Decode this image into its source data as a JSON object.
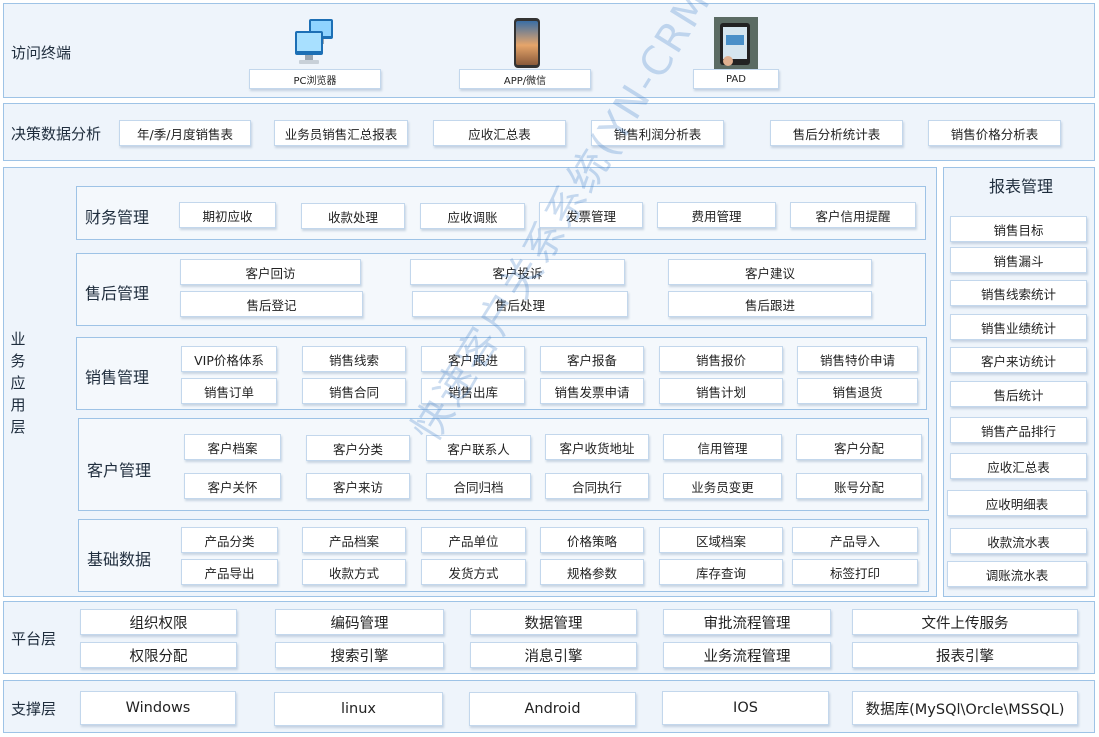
{
  "terminals": {
    "title": "访问终端",
    "items": [
      "PC浏览器",
      "APP/微信",
      "PAD"
    ]
  },
  "decision": {
    "title": "决策数据分析",
    "items": [
      "年/季/月度销售表",
      "业务员销售汇总报表",
      "应收汇总表",
      "销售利润分析表",
      "售后分析统计表",
      "销售价格分析表"
    ]
  },
  "business": {
    "title_chars": [
      "业",
      "务",
      "应",
      "用",
      "层"
    ],
    "finance": {
      "title": "财务管理",
      "items": [
        "期初应收",
        "收款处理",
        "应收调账",
        "发票管理",
        "费用管理",
        "客户信用提醒"
      ]
    },
    "aftersales": {
      "title": "售后管理",
      "items": [
        "客户回访",
        "客户投诉",
        "客户建议",
        "售后登记",
        "售后处理",
        "售后跟进"
      ]
    },
    "sales": {
      "title": "销售管理",
      "items": [
        "VIP价格体系",
        "销售线索",
        "客户跟进",
        "客户报备",
        "销售报价",
        "销售特价申请",
        "销售订单",
        "销售合同",
        "销售出库",
        "销售发票申请",
        "销售计划",
        "销售退货"
      ]
    },
    "customer": {
      "title": "客户管理",
      "items": [
        "客户档案",
        "客户分类",
        "客户联系人",
        "客户收货地址",
        "信用管理",
        "客户分配",
        "客户关怀",
        "客户来访",
        "合同归档",
        "合同执行",
        "业务员变更",
        "账号分配"
      ]
    },
    "basic": {
      "title": "基础数据",
      "items": [
        "产品分类",
        "产品档案",
        "产品单位",
        "价格策略",
        "区域档案",
        "产品导入",
        "产品导出",
        "收款方式",
        "发货方式",
        "规格参数",
        "库存查询",
        "标签打印"
      ]
    }
  },
  "reports": {
    "title": "报表管理",
    "items": [
      "销售目标",
      "销售漏斗",
      "销售线索统计",
      "销售业绩统计",
      "客户来访统计",
      "售后统计",
      "销售产品排行",
      "应收汇总表",
      "应收明细表",
      "收款流水表",
      "调账流水表"
    ]
  },
  "platform": {
    "title": "平台层",
    "items": [
      "组织权限",
      "编码管理",
      "数据管理",
      "审批流程管理",
      "文件上传服务",
      "权限分配",
      "搜索引擎",
      "消息引擎",
      "业务流程管理",
      "报表引擎"
    ]
  },
  "support": {
    "title": "支撑层",
    "items": [
      "Windows",
      "linux",
      "Android",
      "IOS",
      "数据库(MySQl\\Orcle\\MSSQL)"
    ]
  },
  "watermark": "快速客户关系系统(YN-CRM)"
}
